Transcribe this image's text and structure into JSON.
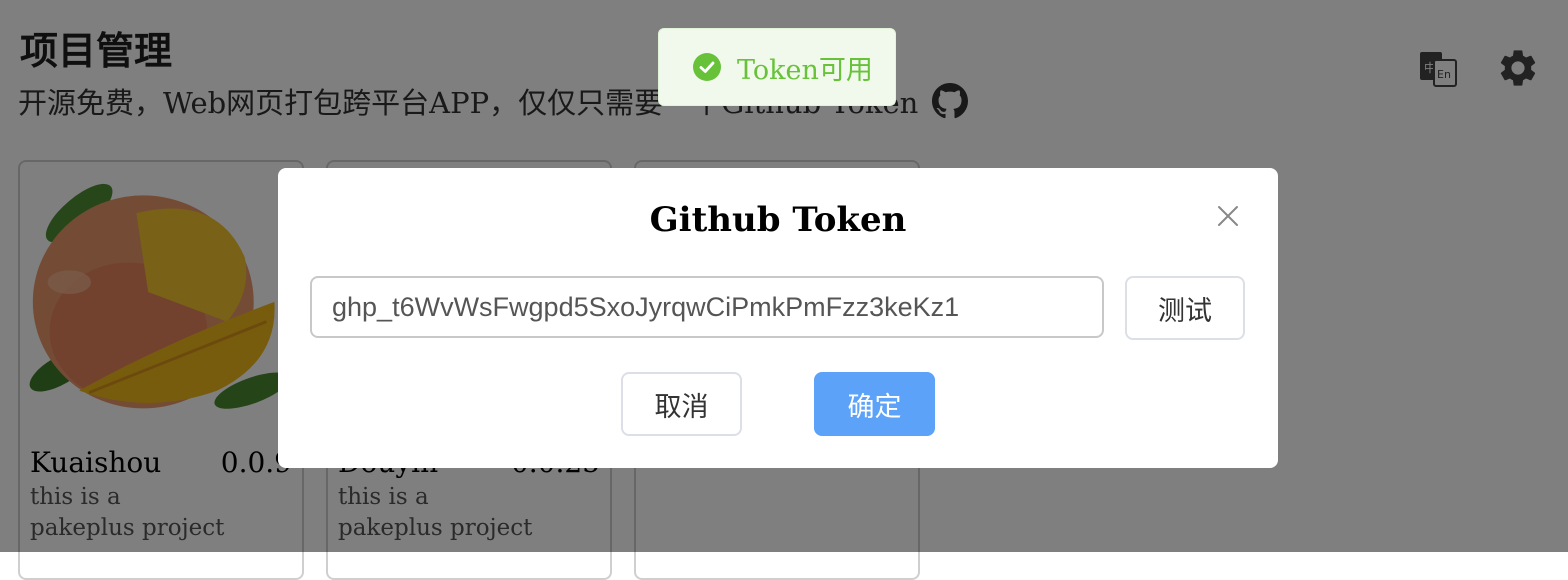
{
  "page": {
    "title": "项目管理",
    "subtitle": "开源免费，Web网页打包跨平台APP，仅仅只需要一个Github Token"
  },
  "header_icons": {
    "language": "translate-icon",
    "settings": "gear-icon",
    "github": "github-icon"
  },
  "projects": [
    {
      "name": "Kuaishou",
      "version": "0.0.9",
      "description": "this is a pakeplus project",
      "image": "mango-image"
    },
    {
      "name": "Douyin",
      "version": "0.0.25",
      "description": "this is a pakeplus project",
      "image": ""
    },
    {
      "name": "",
      "version": "",
      "description": "",
      "image": ""
    }
  ],
  "toast": {
    "icon": "check-circle-icon",
    "text": "Token可用",
    "color": "#67c23a"
  },
  "dialog": {
    "title": "Github Token",
    "token_value": "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",
    "test_label": "测试",
    "cancel_label": "取消",
    "confirm_label": "确定",
    "confirm_color": "#5ba2f8"
  }
}
